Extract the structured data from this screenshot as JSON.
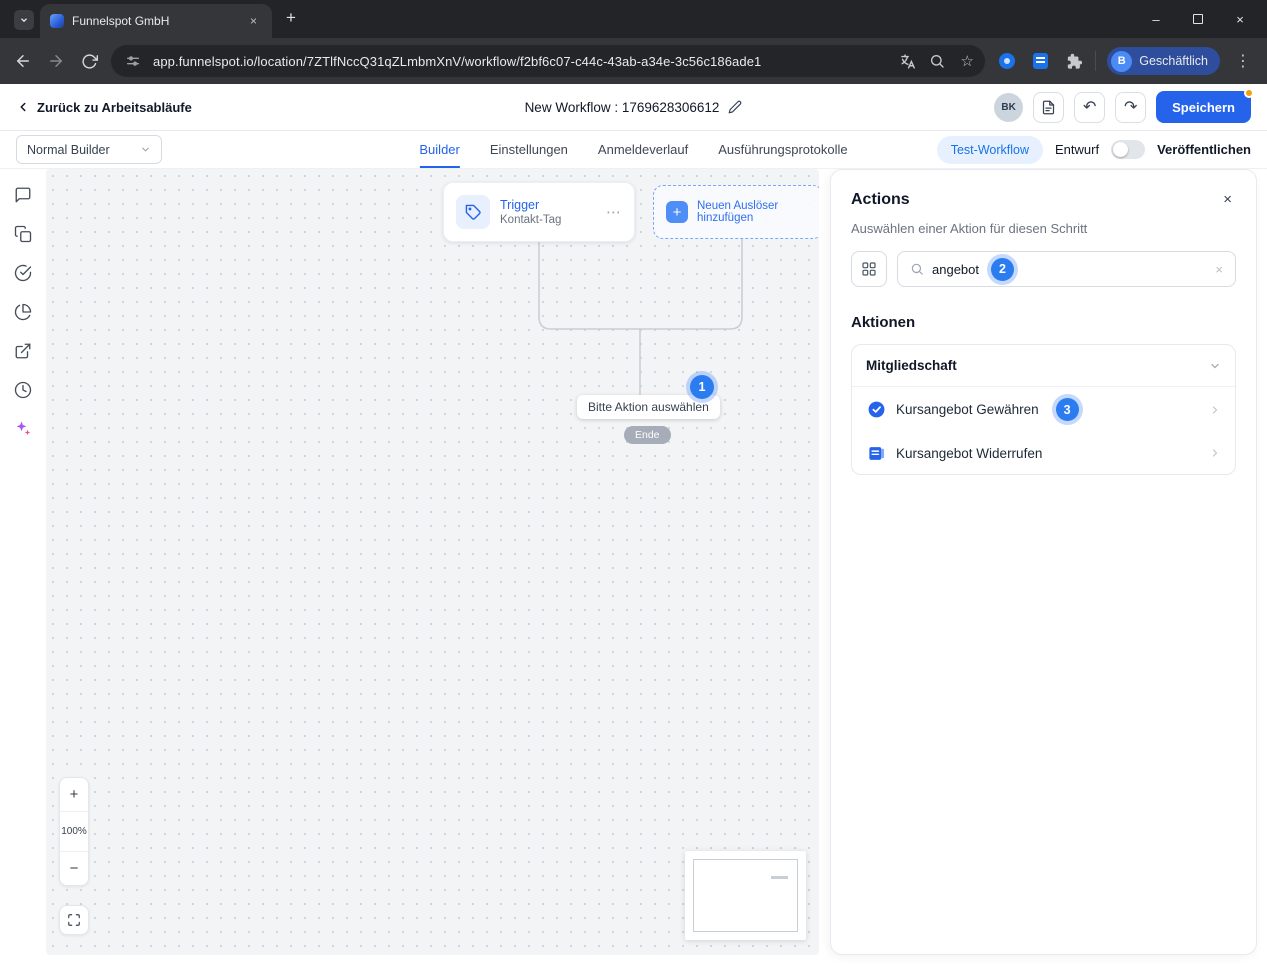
{
  "browser": {
    "tab_title": "Funnelspot GmbH",
    "url": "app.funnelspot.io/location/7ZTlfNccQ31qZLmbmXnV/workflow/f2bf6c07-c44c-43ab-a34e-3c56c186ade1",
    "profile_label": "Geschäftlich",
    "profile_initial": "B"
  },
  "header": {
    "back_label": "Zurück zu Arbeitsabläufe",
    "title": "New Workflow : 1769628306612",
    "avatar_initials": "BK",
    "save_label": "Speichern"
  },
  "subnav": {
    "builder_select": "Normal Builder",
    "tabs": [
      {
        "label": "Builder"
      },
      {
        "label": "Einstellungen"
      },
      {
        "label": "Anmeldeverlauf"
      },
      {
        "label": "Ausführungsprotokolle"
      }
    ],
    "test_workflow": "Test-Workflow",
    "draft_label": "Entwurf",
    "publish_label": "Veröffentlichen"
  },
  "canvas": {
    "trigger_title": "Trigger",
    "trigger_subtitle": "Kontakt-Tag",
    "add_trigger_label": "Neuen Auslöser hinzufügen",
    "choose_action_label": "Bitte Aktion auswählen",
    "end_label": "Ende",
    "zoom_level": "100%",
    "step1": "1"
  },
  "panel": {
    "title": "Actions",
    "subtitle": "Auswählen einer Aktion für diesen Schritt",
    "search_value": "angebot",
    "step2": "2",
    "section_title": "Aktionen",
    "group_title": "Mitgliedschaft",
    "items": [
      {
        "label": "Kursangebot Gewähren",
        "step": "3"
      },
      {
        "label": "Kursangebot Widerrufen"
      }
    ]
  },
  "icons": {
    "close": "×",
    "new_tab": "+",
    "window_min": "–",
    "kebab": "⋮",
    "ellipsis": "⋯",
    "star": "☆",
    "plus": "+",
    "minus": "−",
    "undo": "↶",
    "redo": "↷"
  },
  "colors": {
    "accent": "#2563eb",
    "badge": "#2b7cf0",
    "save_dot": "#f59e0b"
  }
}
